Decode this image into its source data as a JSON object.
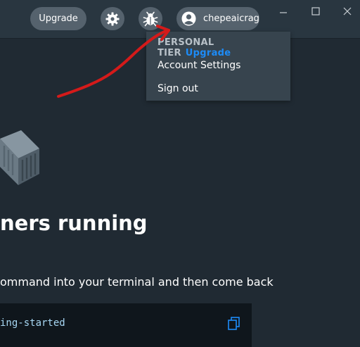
{
  "header": {
    "upgrade_label": "Upgrade",
    "settings_icon": "gear-icon",
    "bug_icon": "bug-icon",
    "user": {
      "name": "chepeaicrag",
      "icon": "user-circle-icon"
    },
    "window_controls": [
      "minimize-icon",
      "maximize-icon",
      "close-icon"
    ]
  },
  "dropdown": {
    "tier_label": "PERSONAL TIER",
    "tier_upgrade": "Upgrade",
    "items": [
      {
        "label": "Account Settings"
      },
      {
        "label": "Sign out"
      }
    ]
  },
  "main": {
    "heading": "ners running",
    "subtext": "ommand into your terminal and then come back",
    "code": "ing-started",
    "copy_icon": "copy-icon"
  },
  "colors": {
    "background": "#202a33",
    "titlebar": "#293640",
    "pill": "#55626d",
    "menu": "#37444e",
    "link": "#1d8cf8",
    "code_text": "#a7d7f3",
    "annotation": "#d41a1a"
  }
}
